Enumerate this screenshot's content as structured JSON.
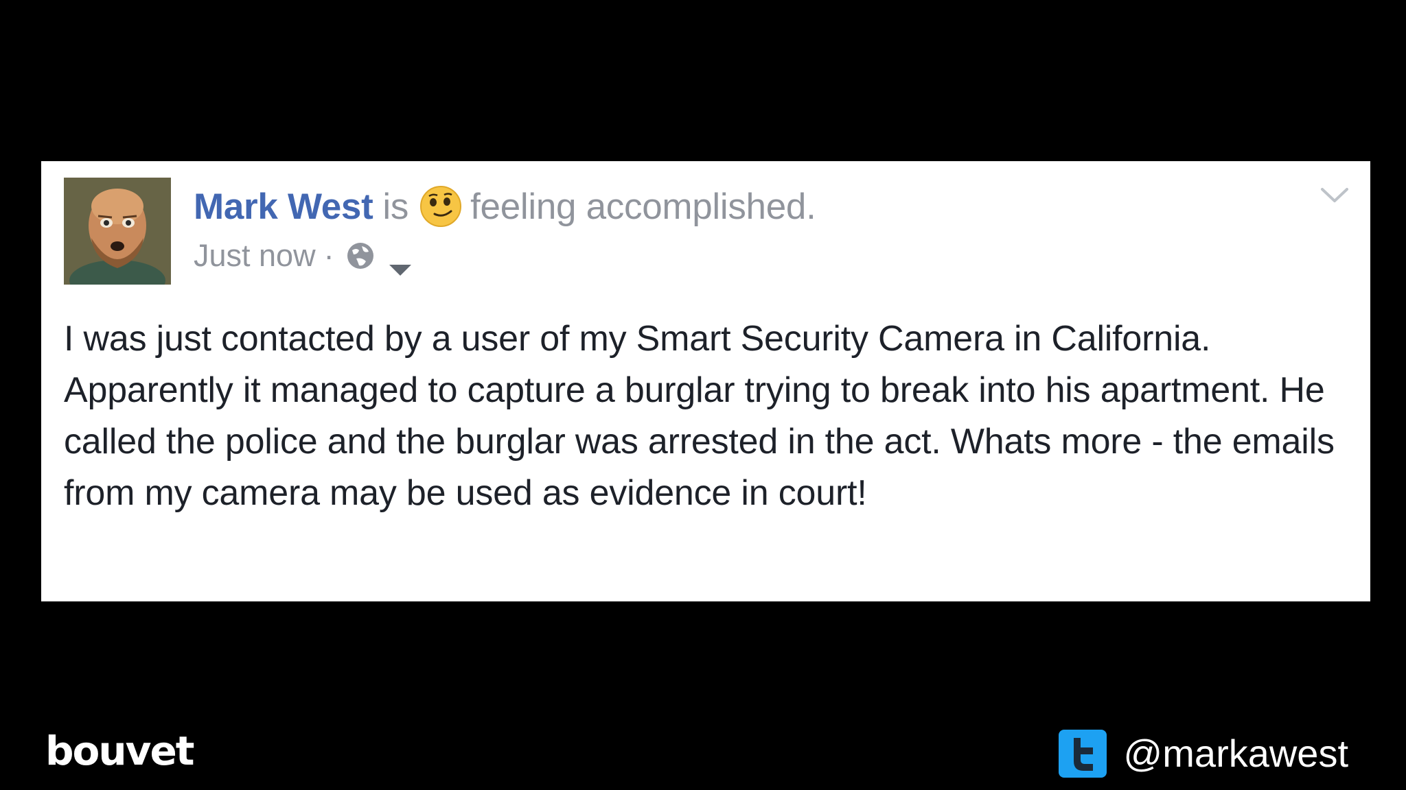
{
  "post": {
    "author": "Mark West",
    "is_word": "is",
    "feeling_icon": "smirk-emoji",
    "feeling": "feeling accomplished.",
    "timestamp": "Just now",
    "meta_separator": "·",
    "privacy_icon": "globe-icon",
    "options_icon": "chevron-down-icon",
    "body": "I was just contacted by a user of my Smart Security Camera in California. Apparently it managed to capture a burglar trying to break into his apartment. He called the police and the burglar was arrested in the act. Whats more - the emails from my camera may be used as evidence in court!"
  },
  "footer": {
    "brand": "bouvet",
    "twitter_icon": "twitter-icon",
    "handle": "@markawest"
  },
  "colors": {
    "background": "#000000",
    "card": "#ffffff",
    "author_link": "#4267b2",
    "muted_text": "#90949c",
    "body_text": "#1d2129",
    "twitter_blue": "#1da1f2"
  }
}
